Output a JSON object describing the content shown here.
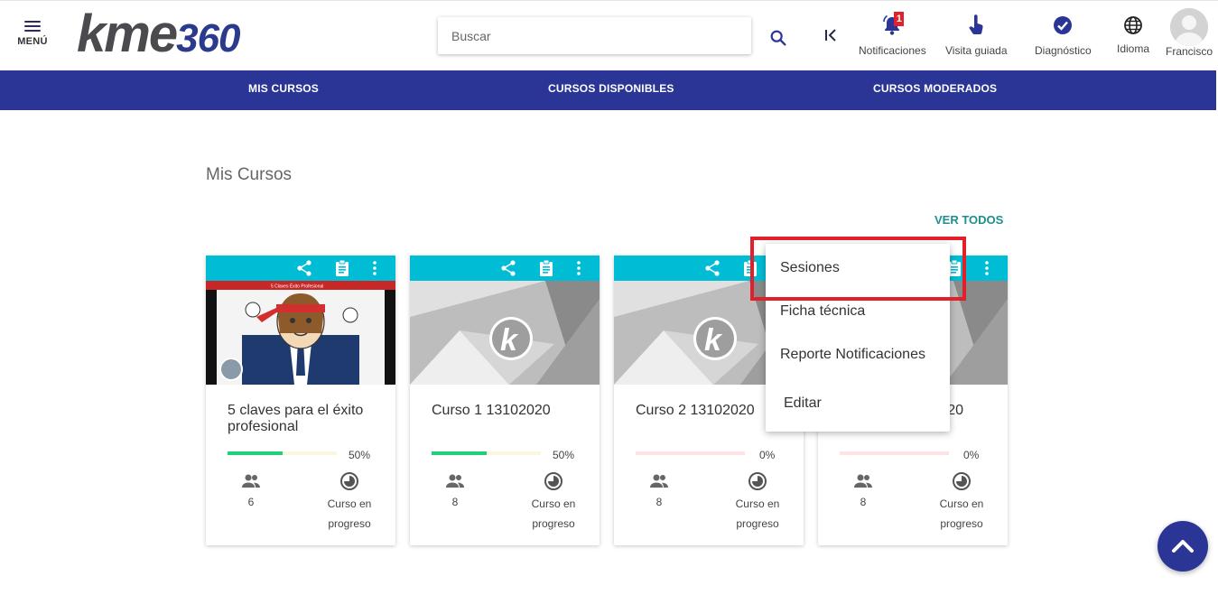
{
  "header": {
    "menu_label": "MENÚ",
    "logo_main": "kme",
    "logo_num": "360",
    "search_placeholder": "Buscar",
    "notifications_label": "Notificaciones",
    "notifications_count": "1",
    "guided_visit_label": "Visita guiada",
    "diagnostic_label": "Diagnóstico",
    "language_label": "Idioma",
    "user_name": "Francisco"
  },
  "nav": {
    "items": [
      "MIS CURSOS",
      "CURSOS DISPONIBLES",
      "CURSOS MODERADOS"
    ]
  },
  "main": {
    "section_title": "Mis Cursos",
    "view_all_label": "VER TODOS"
  },
  "courses": [
    {
      "title": "5 claves para el éxito profesional",
      "progress_label": "50%",
      "progress": 0.5,
      "participants": "6",
      "status_line1": "Curso en",
      "status_line2": "progreso",
      "banner_text": "5 Claves  Éxito Profesional"
    },
    {
      "title": "Curso 1 13102020",
      "progress_label": "50%",
      "progress": 0.5,
      "participants": "8",
      "status_line1": "Curso en",
      "status_line2": "progreso"
    },
    {
      "title": "Curso 2 13102020",
      "progress_label": "0%",
      "progress": 0,
      "participants": "8",
      "status_line1": "Curso en",
      "status_line2": "progreso"
    },
    {
      "title": "20",
      "progress_label": "0%",
      "progress": 0,
      "participants": "8",
      "status_line1": "Curso en",
      "status_line2": "progreso"
    }
  ],
  "dropdown": {
    "items": [
      "Sesiones",
      "Ficha técnica",
      "Reporte Notificaciones",
      "Editar"
    ]
  },
  "colors": {
    "navbar": "#2a3596",
    "card_bar": "#00bcd4",
    "progress_fill": "#1fd07a",
    "accent_link": "#1d8f8f",
    "highlight": "#e0202a"
  }
}
